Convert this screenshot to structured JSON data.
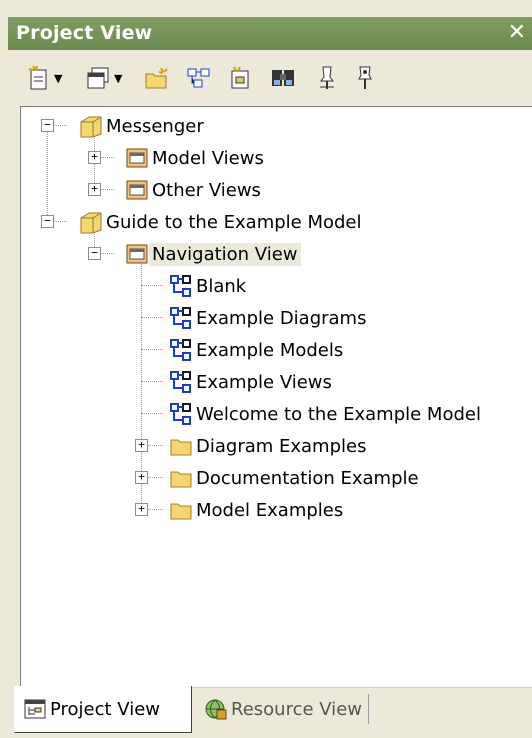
{
  "window": {
    "title": "Project View",
    "close_glyph": "✕"
  },
  "toolbar": {
    "buttons": [
      {
        "icon": "new-document-icon",
        "dropdown": true
      },
      {
        "icon": "new-window-icon",
        "dropdown": true
      },
      {
        "icon": "new-folder-icon",
        "dropdown": false
      },
      {
        "icon": "new-diagram-icon",
        "dropdown": false
      },
      {
        "icon": "new-document-sparkle-icon",
        "dropdown": false
      },
      {
        "icon": "binoculars-icon",
        "dropdown": false
      },
      {
        "icon": "pin-icon",
        "dropdown": false
      },
      {
        "icon": "pin-alt-icon",
        "dropdown": false
      }
    ]
  },
  "tree": {
    "messenger": {
      "label": "Messenger"
    },
    "model_views": {
      "label": "Model Views"
    },
    "other_views": {
      "label": "Other Views"
    },
    "guide": {
      "label": "Guide to the Example Model"
    },
    "navigation_view": {
      "label": "Navigation View"
    },
    "diagrams": [
      {
        "label": "Blank"
      },
      {
        "label": "Example Diagrams"
      },
      {
        "label": "Example Models"
      },
      {
        "label": "Example Views"
      },
      {
        "label": "Welcome to the Example Model"
      }
    ],
    "folders": [
      {
        "label": "Diagram Examples"
      },
      {
        "label": "Documentation Example"
      },
      {
        "label": "Model Examples"
      }
    ]
  },
  "tabs": {
    "project": "Project View",
    "resource": "Resource View"
  },
  "colors": {
    "titlebar": "#7f9d62",
    "selection": "#ebe8dc",
    "folder": "#f5d56b",
    "diagram": "#1a3ccf"
  }
}
